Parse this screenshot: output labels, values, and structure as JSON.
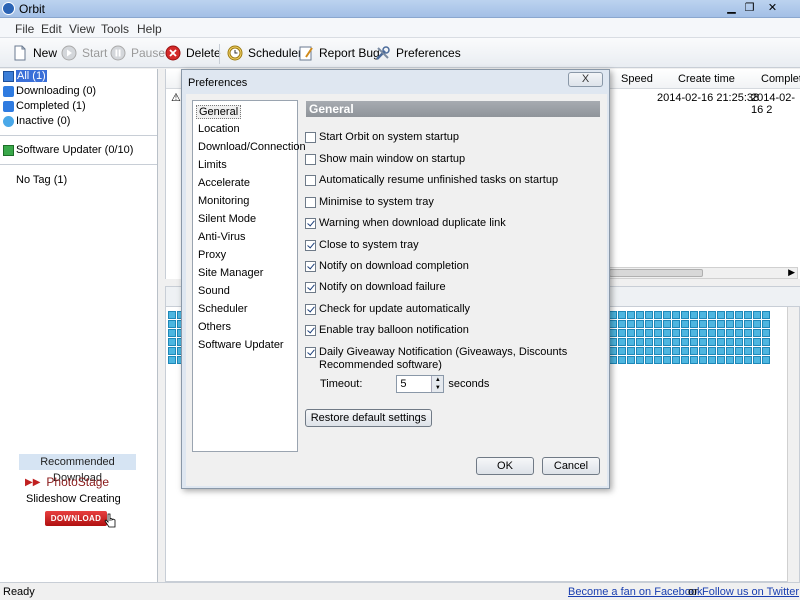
{
  "window": {
    "title": "Orbit"
  },
  "menu": [
    "File",
    "Edit",
    "View",
    "Tools",
    "Help"
  ],
  "toolbar": {
    "new": "New",
    "start": "Start",
    "pause": "Pause",
    "delete": "Delete",
    "scheduler": "Scheduler",
    "report_bug": "Report Bug",
    "preferences": "Preferences"
  },
  "sidebar": {
    "categories": [
      {
        "label": "All (1)"
      },
      {
        "label": "Downloading (0)"
      },
      {
        "label": "Completed (1)"
      },
      {
        "label": "Inactive (0)"
      }
    ],
    "software_updater": "Software Updater (0/10)",
    "no_tag": "No Tag (1)",
    "recommended": "Recommended Download",
    "promo_name": "PhotoStage",
    "promo_desc": "Slideshow Creating",
    "download_btn": "DOWNLOAD"
  },
  "list": {
    "columns": {
      "speed": "Speed",
      "create_time": "Create time",
      "complete": "Complete"
    },
    "row": {
      "create_time": "2014-02-16 21:25:38",
      "complete": "2014-02-16 2"
    }
  },
  "dialog": {
    "title": "Preferences",
    "close": "X",
    "categories": [
      "General",
      "Location",
      "Download/Connection",
      "Limits",
      "Accelerate",
      "Monitoring",
      "Silent Mode",
      "Anti-Virus",
      "Proxy",
      "Site Manager",
      "Sound",
      "Scheduler",
      "Others",
      "Software Updater"
    ],
    "panel_title": "General",
    "options": [
      {
        "label": "Start Orbit on system startup",
        "checked": false
      },
      {
        "label": "Show main window on startup",
        "checked": false
      },
      {
        "label": "Automatically resume unfinished tasks on startup",
        "checked": false
      },
      {
        "label": "Minimise to system tray",
        "checked": false
      },
      {
        "label": "Warning when download duplicate link",
        "checked": true
      },
      {
        "label": "Close to system tray",
        "checked": true
      },
      {
        "label": "Notify on download completion",
        "checked": true
      },
      {
        "label": "Notify on download failure",
        "checked": true
      },
      {
        "label": "Check for update automatically",
        "checked": true
      },
      {
        "label": "Enable tray balloon notification",
        "checked": true
      },
      {
        "label": "Daily Giveaway Notification (Giveaways, Discounts Recommended software)",
        "checked": true
      }
    ],
    "timeout_label": "Timeout:",
    "timeout_value": "5",
    "timeout_unit": "seconds",
    "restore": "Restore default settings",
    "ok": "OK",
    "cancel": "Cancel"
  },
  "status": {
    "text": "Ready",
    "facebook": "Become a fan on Facebook",
    "or": "or",
    "twitter": "Follow us on Twitter"
  }
}
